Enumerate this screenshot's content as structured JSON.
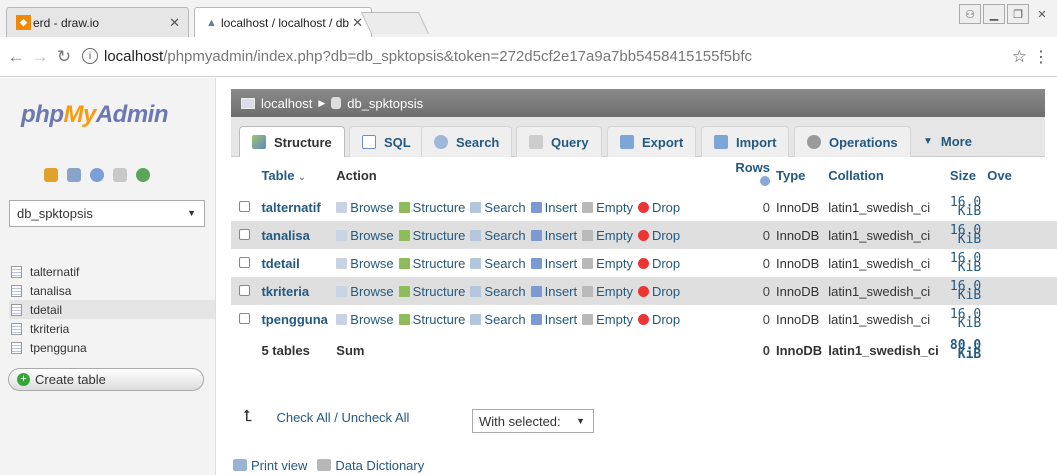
{
  "browser": {
    "tabs": [
      {
        "title": "erd - draw.io",
        "icon": "drawio-icon"
      },
      {
        "title": "localhost / localhost / db",
        "icon": "phpmyadmin-icon"
      }
    ],
    "url_host": "localhost",
    "url_rest": "/phpmyadmin/index.php?db=db_spktopsis&token=272d5cf2e17a9a7bb5458415155f5bfc",
    "window_buttons": [
      "user",
      "minimize",
      "restore",
      "close"
    ]
  },
  "sidebar": {
    "logo": {
      "php": "php",
      "my": "My",
      "admin": "Admin"
    },
    "db_select": "db_spktopsis",
    "tables": [
      "talternatif",
      "tanalisa",
      "tdetail",
      "tkriteria",
      "tpengguna"
    ],
    "selected_table": "tdetail",
    "create_table": "Create table"
  },
  "breadcrumb": {
    "server": "localhost",
    "database": "db_spktopsis"
  },
  "menu_tabs": [
    "Structure",
    "SQL",
    "Search",
    "Query",
    "Export",
    "Import",
    "Operations",
    "More"
  ],
  "table": {
    "headers": {
      "table": "Table",
      "sort": "⌄",
      "action": "Action",
      "rows": "Rows",
      "type": "Type",
      "collation": "Collation",
      "size": "Size",
      "overhead": "Ove"
    },
    "actions": [
      "Browse",
      "Structure",
      "Search",
      "Insert",
      "Empty",
      "Drop"
    ],
    "rows": [
      {
        "name": "talternatif",
        "rows": "0",
        "type": "InnoDB",
        "collation": "latin1_swedish_ci",
        "size": "16.0",
        "unit": "KiB"
      },
      {
        "name": "tanalisa",
        "rows": "0",
        "type": "InnoDB",
        "collation": "latin1_swedish_ci",
        "size": "16.0",
        "unit": "KiB"
      },
      {
        "name": "tdetail",
        "rows": "0",
        "type": "InnoDB",
        "collation": "latin1_swedish_ci",
        "size": "16.0",
        "unit": "KiB"
      },
      {
        "name": "tkriteria",
        "rows": "0",
        "type": "InnoDB",
        "collation": "latin1_swedish_ci",
        "size": "16.0",
        "unit": "KiB"
      },
      {
        "name": "tpengguna",
        "rows": "0",
        "type": "InnoDB",
        "collation": "latin1_swedish_ci",
        "size": "16.0",
        "unit": "KiB"
      }
    ],
    "summary": {
      "tables": "5 tables",
      "label": "Sum",
      "rows": "0",
      "type": "InnoDB",
      "collation": "latin1_swedish_ci",
      "size": "80.0",
      "unit": "KiB"
    }
  },
  "footer": {
    "check_all": "Check All / Uncheck All",
    "with_selected": "With selected:",
    "print_view": "Print view",
    "data_dictionary": "Data Dictionary"
  },
  "colors": {
    "link": "#235a81",
    "logo_blue": "#6c78af",
    "logo_orange": "#f89c0e"
  }
}
